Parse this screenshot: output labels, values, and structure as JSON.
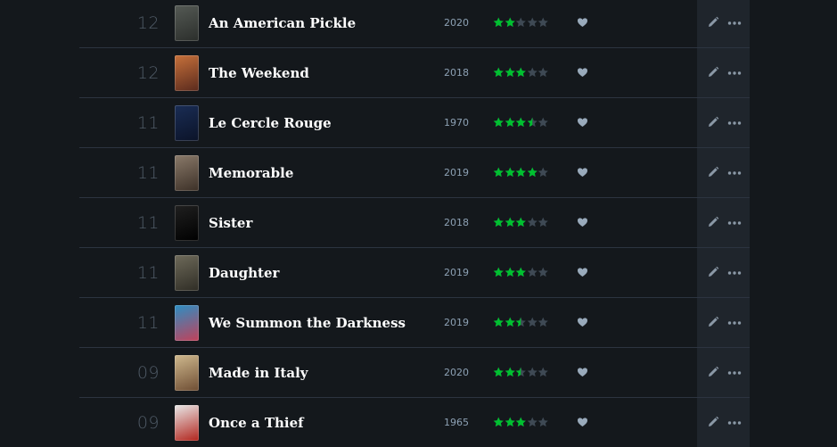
{
  "colors": {
    "background": "#14181c",
    "actions_column": "#1f252c",
    "star_filled": "#00c030",
    "star_empty": "#3e4954",
    "like": "#9ab",
    "divider": "#2c3440"
  },
  "diary": {
    "entries": [
      {
        "day": "12",
        "title": "An American Pickle",
        "year": "2020",
        "rating": 2,
        "liked": true,
        "poster_colors": [
          "#555a55",
          "#2b2e2b"
        ]
      },
      {
        "day": "12",
        "title": "The Weekend",
        "year": "2018",
        "rating": 3,
        "liked": true,
        "poster_colors": [
          "#c7713b",
          "#5a2a1d"
        ]
      },
      {
        "day": "11",
        "title": "Le Cercle Rouge",
        "year": "1970",
        "rating": 3.5,
        "liked": true,
        "poster_colors": [
          "#1a2d55",
          "#0b1328"
        ]
      },
      {
        "day": "11",
        "title": "Memorable",
        "year": "2019",
        "rating": 4,
        "liked": true,
        "poster_colors": [
          "#8a7a6a",
          "#3c3027"
        ]
      },
      {
        "day": "11",
        "title": "Sister",
        "year": "2018",
        "rating": 3,
        "liked": true,
        "poster_colors": [
          "#202020",
          "#000000"
        ]
      },
      {
        "day": "11",
        "title": "Daughter",
        "year": "2019",
        "rating": 3,
        "liked": true,
        "poster_colors": [
          "#6e6a5a",
          "#2f2d25"
        ]
      },
      {
        "day": "11",
        "title": "We Summon the Darkness",
        "year": "2019",
        "rating": 2.5,
        "liked": true,
        "poster_colors": [
          "#2c8fc4",
          "#c1415a"
        ]
      },
      {
        "day": "09",
        "title": "Made in Italy",
        "year": "2020",
        "rating": 2.5,
        "liked": true,
        "poster_colors": [
          "#cfb98e",
          "#6e4d33"
        ]
      },
      {
        "day": "09",
        "title": "Once a Thief",
        "year": "1965",
        "rating": 3,
        "liked": true,
        "poster_colors": [
          "#e8e8e8",
          "#b2241c"
        ]
      }
    ]
  },
  "icons": {
    "edit": "pencil-icon",
    "more": "ellipsis-icon",
    "like": "heart-icon",
    "star": "star-icon"
  }
}
